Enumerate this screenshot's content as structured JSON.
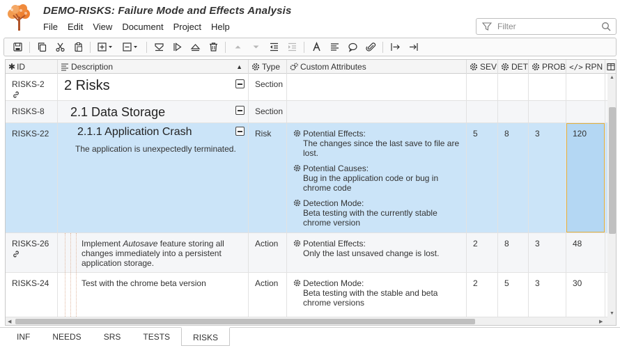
{
  "app": {
    "title": "DEMO-RISKS: Failure Mode and Effects Analysis"
  },
  "menu": [
    "File",
    "Edit",
    "View",
    "Document",
    "Project",
    "Help"
  ],
  "filter": {
    "placeholder": "Filter"
  },
  "toolbar": {
    "icons": [
      "save-icon",
      "copy-icon",
      "cut-icon",
      "paste-icon",
      "add-row-dropdown-icon",
      "remove-row-dropdown-icon",
      "filter-rows-icon",
      "next-icon",
      "expand-icon",
      "delete-icon",
      "move-up-icon",
      "move-down-icon",
      "outdent-icon",
      "indent-icon",
      "font-icon",
      "align-icon",
      "comment-icon",
      "attachment-icon",
      "go-in-icon",
      "go-end-icon"
    ]
  },
  "columns": {
    "id": "ID",
    "description": "Description",
    "type": "Type",
    "custom": "Custom Attributes",
    "sev": "SEV",
    "det": "DET",
    "prob": "PROB",
    "rpn": "RPN"
  },
  "rows": [
    {
      "id": "RISKS-2",
      "heading": "2 Risks",
      "type": "Section"
    },
    {
      "id": "RISKS-8",
      "heading": "2.1 Data Storage",
      "type": "Section"
    },
    {
      "id": "RISKS-22",
      "heading": "2.1.1 Application Crash",
      "desc": "The application is unexpectedly terminated.",
      "type": "Risk",
      "attrs": [
        {
          "label": "Potential Effects:",
          "value": "The changes since the last save to file are lost."
        },
        {
          "label": "Potential Causes:",
          "value": "Bug in the application code or bug in chrome code"
        },
        {
          "label": "Detection Mode:",
          "value": "Beta testing with the currently stable chrome version"
        }
      ],
      "sev": "5",
      "det": "8",
      "prob": "3",
      "rpn": "120"
    },
    {
      "id": "RISKS-26",
      "desc_pre": "Implement ",
      "desc_em": "Autosave",
      "desc_post": " feature storing all changes immediately into a persistent application storage.",
      "type": "Action",
      "attrs": [
        {
          "label": "Potential Effects:",
          "value": "Only the last unsaved change is lost."
        }
      ],
      "sev": "2",
      "det": "8",
      "prob": "3",
      "rpn": "48"
    },
    {
      "id": "RISKS-24",
      "desc": "Test with the chrome beta version",
      "type": "Action",
      "attrs": [
        {
          "label": "Detection Mode:",
          "value": "Beta testing with the stable and beta chrome versions"
        }
      ],
      "sev": "2",
      "det": "5",
      "prob": "3",
      "rpn": "30"
    }
  ],
  "tabs": [
    "INF",
    "NEEDS",
    "SRS",
    "TESTS",
    "RISKS"
  ],
  "active_tab": "RISKS",
  "colors": {
    "selection": "#cbe4f8",
    "rpn_highlight": "#b4d7f3",
    "accent_border": "#e0b040"
  }
}
